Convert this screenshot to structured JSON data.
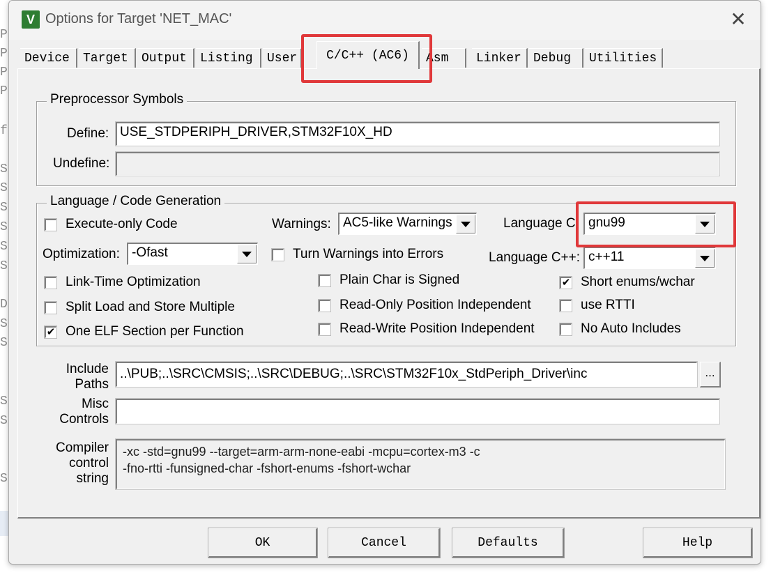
{
  "window": {
    "title": "Options for Target 'NET_MAC'",
    "app_icon_glyph": "V",
    "close_glyph": "✕"
  },
  "background_editor": {
    "letters": [
      "P",
      "P",
      "P",
      "P",
      "f",
      "S",
      "S",
      "S",
      "S",
      "S",
      "S",
      "D",
      "S",
      "S",
      "S",
      "S",
      "S"
    ]
  },
  "tabs": [
    {
      "label": "Device"
    },
    {
      "label": "Target"
    },
    {
      "label": "Output"
    },
    {
      "label": "Listing"
    },
    {
      "label": "User"
    },
    {
      "label": "C/C++ (AC6)",
      "active": true
    },
    {
      "label": "Asm"
    },
    {
      "label": "Linker"
    },
    {
      "label": "Debug"
    },
    {
      "label": "Utilities"
    }
  ],
  "preprocessor": {
    "group_title": "Preprocessor Symbols",
    "define_label": "Define:",
    "define_value": "USE_STDPERIPH_DRIVER,STM32F10X_HD",
    "undefine_label": "Undefine:",
    "undefine_value": ""
  },
  "language": {
    "group_title": "Language / Code Generation",
    "execute_only_label": "Execute-only Code",
    "execute_only_checked": false,
    "optimization_label": "Optimization:",
    "optimization_value": "-Ofast",
    "lto_label": "Link-Time Optimization",
    "lto_checked": false,
    "split_ldm_label": "Split Load and Store Multiple",
    "split_ldm_checked": false,
    "one_elf_label": "One ELF Section per Function",
    "one_elf_checked": true,
    "warnings_label": "Warnings:",
    "warnings_value": "AC5-like Warnings",
    "turn_warnings_label": "Turn Warnings into Errors",
    "turn_warnings_checked": false,
    "plain_char_label": "Plain Char is Signed",
    "plain_char_checked": false,
    "ropi_label": "Read-Only Position Independent",
    "ropi_checked": false,
    "rwpi_label": "Read-Write Position Independent",
    "rwpi_checked": false,
    "language_c_label": "Language C:",
    "language_c_value": "gnu99",
    "language_cpp_label": "Language C++:",
    "language_cpp_value": "c++11",
    "short_enums_label": "Short enums/wchar",
    "short_enums_checked": true,
    "rtti_label": "use RTTI",
    "rtti_checked": false,
    "no_auto_includes_label": "No Auto Includes",
    "no_auto_includes_checked": false
  },
  "include": {
    "label_line1": "Include",
    "label_line2": "Paths",
    "value": "..\\PUB;..\\SRC\\CMSIS;..\\SRC\\DEBUG;..\\SRC\\STM32F10x_StdPeriph_Driver\\inc",
    "browse_label": "..."
  },
  "misc": {
    "label_line1": "Misc",
    "label_line2": "Controls",
    "value": ""
  },
  "compiler": {
    "label_line1": "Compiler",
    "label_line2": "control",
    "label_line3": "string",
    "value": "-xc -std=gnu99 --target=arm-arm-none-eabi -mcpu=cortex-m3 -c\n-fno-rtti -funsigned-char -fshort-enums -fshort-wchar"
  },
  "buttons": {
    "ok": "OK",
    "cancel": "Cancel",
    "defaults": "Defaults",
    "help": "Help"
  },
  "colors": {
    "highlight": "#e0383a",
    "dialog_bg": "#f0f0f0",
    "icon_green": "#2e7d32"
  }
}
